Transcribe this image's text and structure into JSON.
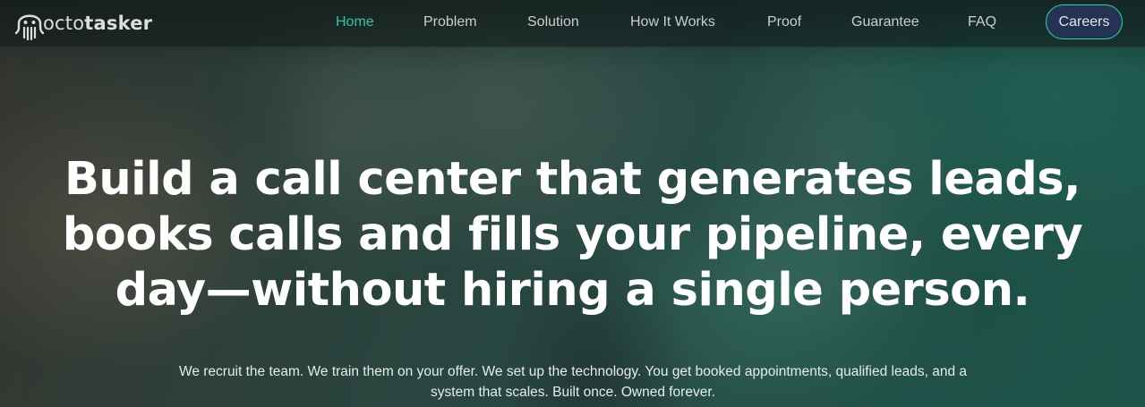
{
  "brand": {
    "logo_icon": "octopus-icon",
    "name_part_light": "octo",
    "name_part_bold": "tasker"
  },
  "nav": {
    "items": [
      {
        "label": "Home",
        "active": true
      },
      {
        "label": "Problem",
        "active": false
      },
      {
        "label": "Solution",
        "active": false
      },
      {
        "label": "How It Works",
        "active": false
      },
      {
        "label": "Proof",
        "active": false
      },
      {
        "label": "Guarantee",
        "active": false
      },
      {
        "label": "FAQ",
        "active": false
      }
    ],
    "cta_label": "Careers"
  },
  "hero": {
    "headline": "Build a call center that generates leads, books calls and fills your pipeline, every day—without hiring a single person.",
    "subtext": "We recruit the team. We train them on your offer. We set up the technology. You get booked appointments, qualified leads, and a system that scales. Built once. Owned forever."
  },
  "colors": {
    "accent": "#33c6a6",
    "cta_border": "#2fd3b0",
    "cta_background": "#28345a",
    "text_primary": "#ffffff",
    "nav_text": "#c9cfce"
  }
}
